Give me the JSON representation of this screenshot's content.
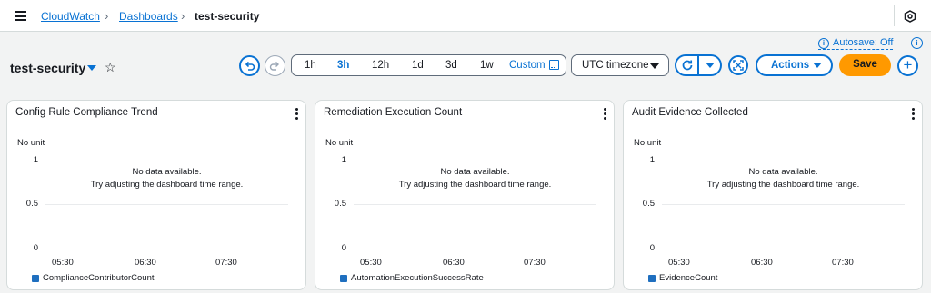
{
  "breadcrumb": {
    "items": [
      {
        "label": "CloudWatch"
      },
      {
        "label": "Dashboards"
      },
      {
        "label": "test-security"
      }
    ]
  },
  "header": {
    "autosave_label": "Autosave: Off",
    "dashboard_title": "test-security"
  },
  "time_range": {
    "options": [
      "1h",
      "3h",
      "12h",
      "1d",
      "3d",
      "1w"
    ],
    "active": "3h",
    "custom_label": "Custom"
  },
  "timezone": {
    "selected": "UTC timezone"
  },
  "toolbar": {
    "actions_label": "Actions",
    "save_label": "Save",
    "add_label": "+"
  },
  "colors": {
    "accent": "#0972d3",
    "primary_button": "#ff9900",
    "series": "#1f6fbf"
  },
  "widgets": [
    {
      "title": "Config Rule Compliance Trend",
      "unit": "No unit",
      "y_ticks": [
        "1",
        "0.5",
        "0"
      ],
      "x_ticks": [
        "05:30",
        "06:30",
        "07:30"
      ],
      "no_data_line1": "No data available.",
      "no_data_line2": "Try adjusting the dashboard time range.",
      "legend": "ComplianceContributorCount"
    },
    {
      "title": "Remediation Execution Count",
      "unit": "No unit",
      "y_ticks": [
        "1",
        "0.5",
        "0"
      ],
      "x_ticks": [
        "05:30",
        "06:30",
        "07:30"
      ],
      "no_data_line1": "No data available.",
      "no_data_line2": "Try adjusting the dashboard time range.",
      "legend": "AutomationExecutionSuccessRate"
    },
    {
      "title": "Audit Evidence Collected",
      "unit": "No unit",
      "y_ticks": [
        "1",
        "0.5",
        "0"
      ],
      "x_ticks": [
        "05:30",
        "06:30",
        "07:30"
      ],
      "no_data_line1": "No data available.",
      "no_data_line2": "Try adjusting the dashboard time range.",
      "legend": "EvidenceCount"
    }
  ]
}
